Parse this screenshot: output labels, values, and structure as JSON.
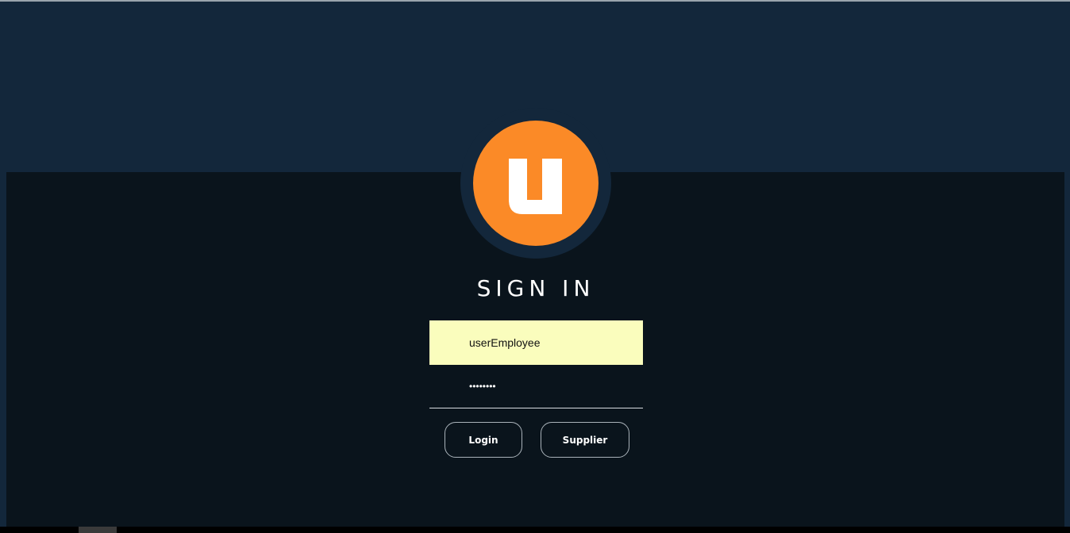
{
  "page": {
    "title": "SIGN IN"
  },
  "login_form": {
    "username_value": "userEmployee",
    "password_value": "••••••••",
    "login_label": "Login",
    "supplier_label": "Supplier"
  },
  "logo": {
    "icon": "u-logo-icon",
    "letter": "u"
  },
  "colors": {
    "header_bg": "#13273b",
    "panel_bg": "#0a141c",
    "accent_orange": "#fb8a27",
    "input_fill": "#fafdbd"
  },
  "taskbar": {
    "clock_partial": ""
  }
}
